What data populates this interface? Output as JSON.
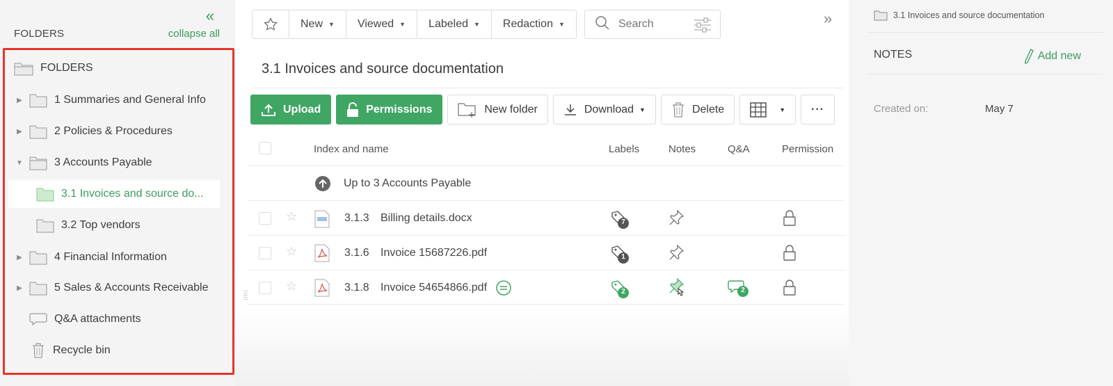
{
  "sidebar": {
    "title": "FOLDERS",
    "collapse_label": "collapse all",
    "root_label": "FOLDERS",
    "items": [
      {
        "label": "1 Summaries and General Info"
      },
      {
        "label": "2 Policies & Procedures"
      },
      {
        "label": "3 Accounts Payable"
      },
      {
        "label": "3.1 Invoices and source do..."
      },
      {
        "label": "3.2 Top vendors"
      },
      {
        "label": "4 Financial Information"
      },
      {
        "label": "5 Sales & Accounts Receivable"
      },
      {
        "label": "Q&A attachments"
      },
      {
        "label": "Recycle bin"
      }
    ]
  },
  "toolbar": {
    "new_label": "New",
    "viewed_label": "Viewed",
    "labeled_label": "Labeled",
    "redaction_label": "Redaction",
    "search_placeholder": "Search"
  },
  "main": {
    "title": "3.1 Invoices and source documentation",
    "actions": {
      "upload": "Upload",
      "permissions": "Permissions",
      "new_folder": "New folder",
      "download": "Download",
      "delete": "Delete",
      "more": "···"
    },
    "columns": {
      "name": "Index and name",
      "labels": "Labels",
      "notes": "Notes",
      "qa": "Q&A",
      "permission": "Permission"
    },
    "up_link": "Up to 3 Accounts Payable",
    "rows": [
      {
        "index": "3.1.3",
        "name": "Billing details.docx",
        "labels_count": "7",
        "qa_count": ""
      },
      {
        "index": "3.1.6",
        "name": "Invoice 15687226.pdf",
        "labels_count": "1",
        "qa_count": ""
      },
      {
        "index": "3.1.8",
        "name": "Invoice 54654866.pdf",
        "labels_count": "2",
        "qa_count": "2"
      }
    ]
  },
  "right_panel": {
    "path": "3.1 Invoices and source documentation",
    "notes_title": "NOTES",
    "add_new": "Add new",
    "created_label": "Created on:",
    "created_value": "May 7"
  },
  "colors": {
    "accent": "#3c9a5f",
    "button_green": "#3fa664",
    "highlight_border": "#e8342a"
  }
}
